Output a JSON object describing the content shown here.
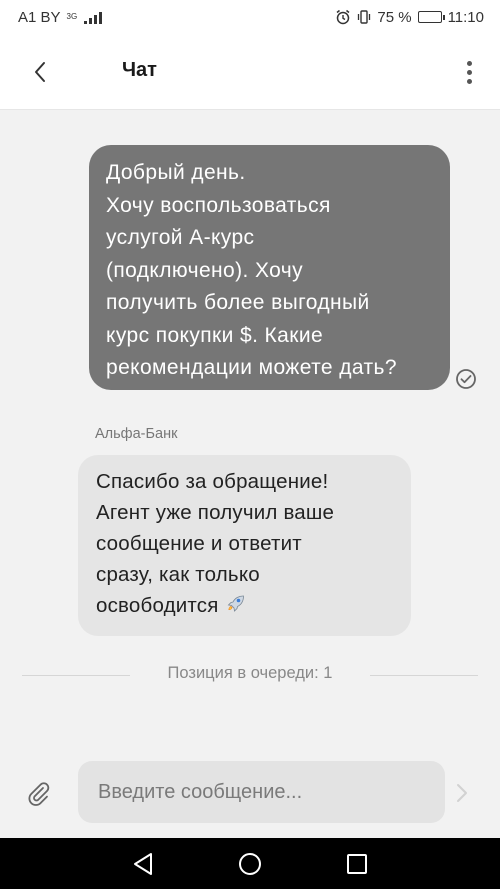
{
  "status_bar": {
    "carrier": "A1 BY",
    "network": "3G",
    "battery_percent": "75 %",
    "battery_level": 0.75,
    "time": "11:10"
  },
  "header": {
    "title": "Чат"
  },
  "messages": [
    {
      "direction": "outgoing",
      "text": "Добрый день.\nХочу воспользоваться\nуслугой А-курс\n(подключено). Хочу\nполучить более выгодный\nкурс покупки $. Какие\nрекомендации можете дать?",
      "status_icon": "check-circle-icon"
    },
    {
      "direction": "incoming",
      "sender": "Альфа-Банк",
      "text": "Спасибо за обращение!\nАгент уже получил ваше\nсообщение и ответит\nсразу, как только\nосвободится",
      "emoji": "rocket-icon"
    }
  ],
  "queue": {
    "text": "Позиция в очереди: 1"
  },
  "composer": {
    "placeholder": "Введите сообщение..."
  },
  "colors": {
    "outgoing_bubble": "#767676",
    "incoming_bubble": "#e5e5e5",
    "background": "#f2f2f2"
  }
}
